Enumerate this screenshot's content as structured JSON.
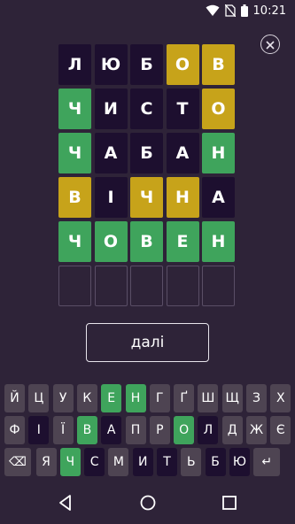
{
  "status": {
    "time": "10:21"
  },
  "board": {
    "rows": [
      {
        "tiles": [
          {
            "letter": "Л",
            "state": "absent"
          },
          {
            "letter": "Ю",
            "state": "absent"
          },
          {
            "letter": "Б",
            "state": "absent"
          },
          {
            "letter": "О",
            "state": "present"
          },
          {
            "letter": "В",
            "state": "present"
          }
        ]
      },
      {
        "tiles": [
          {
            "letter": "Ч",
            "state": "correct"
          },
          {
            "letter": "И",
            "state": "absent"
          },
          {
            "letter": "С",
            "state": "absent"
          },
          {
            "letter": "Т",
            "state": "absent"
          },
          {
            "letter": "О",
            "state": "present"
          }
        ]
      },
      {
        "tiles": [
          {
            "letter": "Ч",
            "state": "correct"
          },
          {
            "letter": "А",
            "state": "absent"
          },
          {
            "letter": "Б",
            "state": "absent"
          },
          {
            "letter": "А",
            "state": "absent"
          },
          {
            "letter": "Н",
            "state": "correct"
          }
        ]
      },
      {
        "tiles": [
          {
            "letter": "В",
            "state": "present"
          },
          {
            "letter": "І",
            "state": "absent"
          },
          {
            "letter": "Ч",
            "state": "present"
          },
          {
            "letter": "Н",
            "state": "present"
          },
          {
            "letter": "А",
            "state": "absent"
          }
        ]
      },
      {
        "tiles": [
          {
            "letter": "Ч",
            "state": "correct"
          },
          {
            "letter": "О",
            "state": "correct"
          },
          {
            "letter": "В",
            "state": "correct"
          },
          {
            "letter": "Е",
            "state": "correct"
          },
          {
            "letter": "Н",
            "state": "correct"
          }
        ]
      },
      {
        "tiles": [
          {
            "letter": "",
            "state": "empty"
          },
          {
            "letter": "",
            "state": "empty"
          },
          {
            "letter": "",
            "state": "empty"
          },
          {
            "letter": "",
            "state": "empty"
          },
          {
            "letter": "",
            "state": "empty"
          }
        ]
      }
    ]
  },
  "next_button": {
    "label": "далі"
  },
  "keyboard": {
    "rows": [
      {
        "keys": [
          {
            "label": "Й",
            "state": "unused"
          },
          {
            "label": "Ц",
            "state": "unused"
          },
          {
            "label": "У",
            "state": "unused"
          },
          {
            "label": "К",
            "state": "unused"
          },
          {
            "label": "Е",
            "state": "correct"
          },
          {
            "label": "Н",
            "state": "correct"
          },
          {
            "label": "Г",
            "state": "unused"
          },
          {
            "label": "Ґ",
            "state": "unused"
          },
          {
            "label": "Ш",
            "state": "unused"
          },
          {
            "label": "Щ",
            "state": "unused"
          },
          {
            "label": "З",
            "state": "unused"
          },
          {
            "label": "Х",
            "state": "unused"
          }
        ]
      },
      {
        "keys": [
          {
            "label": "Ф",
            "state": "unused"
          },
          {
            "label": "І",
            "state": "absent"
          },
          {
            "label": "Ї",
            "state": "unused"
          },
          {
            "label": "В",
            "state": "correct"
          },
          {
            "label": "А",
            "state": "absent"
          },
          {
            "label": "П",
            "state": "unused"
          },
          {
            "label": "Р",
            "state": "unused"
          },
          {
            "label": "О",
            "state": "correct"
          },
          {
            "label": "Л",
            "state": "absent"
          },
          {
            "label": "Д",
            "state": "unused"
          },
          {
            "label": "Ж",
            "state": "unused"
          },
          {
            "label": "Є",
            "state": "unused"
          }
        ]
      },
      {
        "keys": [
          {
            "label": "⌫",
            "state": "unused",
            "icon": "backspace-icon",
            "wide": true
          },
          {
            "label": "Я",
            "state": "unused"
          },
          {
            "label": "Ч",
            "state": "correct"
          },
          {
            "label": "С",
            "state": "absent"
          },
          {
            "label": "М",
            "state": "unused"
          },
          {
            "label": "И",
            "state": "absent"
          },
          {
            "label": "Т",
            "state": "absent"
          },
          {
            "label": "Ь",
            "state": "unused"
          },
          {
            "label": "Б",
            "state": "absent"
          },
          {
            "label": "Ю",
            "state": "absent"
          },
          {
            "label": "↵",
            "state": "unused",
            "icon": "enter-icon",
            "wide": true
          }
        ]
      }
    ]
  },
  "colors": {
    "background": "#2e2338",
    "absent": "#1d0f2f",
    "present": "#c7a31a",
    "correct": "#3fa45c",
    "unused": "#4e4452"
  },
  "icons": {
    "status": [
      "wifi-icon",
      "no-sim-icon",
      "battery-icon"
    ],
    "close": "close-icon",
    "nav": [
      "back-icon",
      "home-icon",
      "recents-icon"
    ]
  }
}
